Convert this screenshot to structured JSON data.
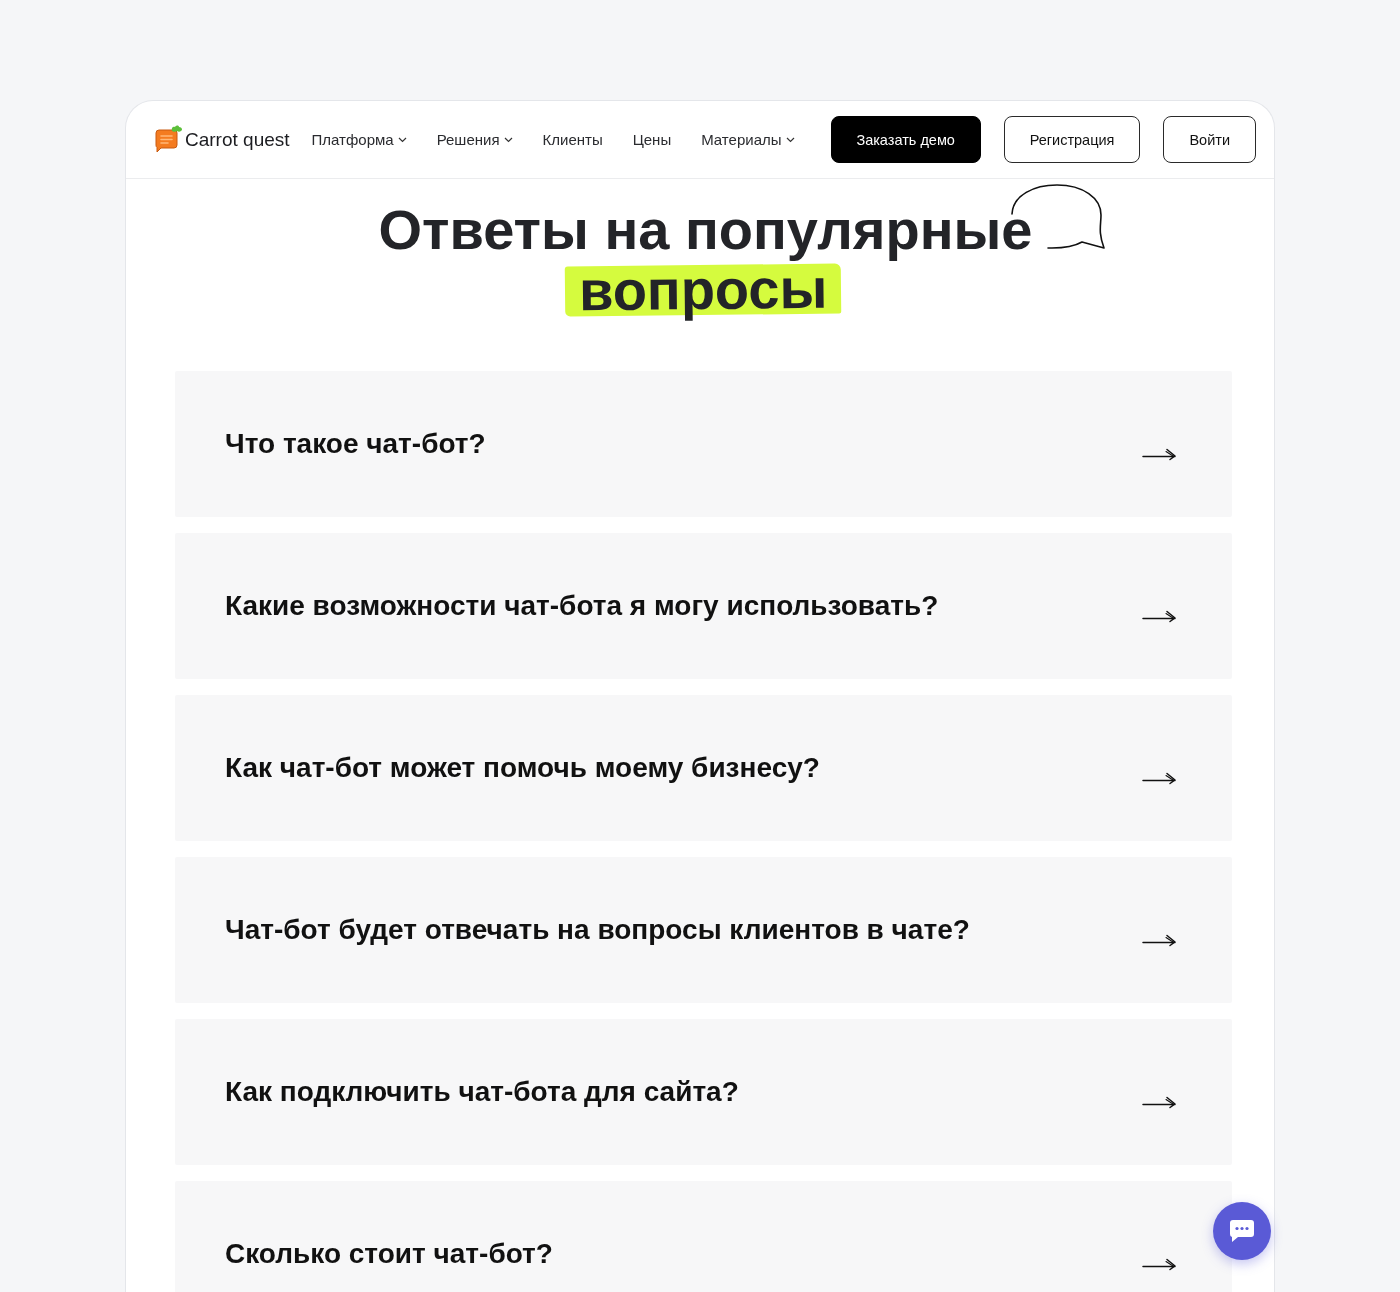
{
  "header": {
    "logo": {
      "text": "Carrot quest"
    },
    "nav": [
      {
        "label": "Платформа",
        "dropdown": true
      },
      {
        "label": "Решения",
        "dropdown": true
      },
      {
        "label": "Клиенты",
        "dropdown": false
      },
      {
        "label": "Цены",
        "dropdown": false
      },
      {
        "label": "Материалы",
        "dropdown": true
      }
    ],
    "buttons": [
      {
        "label": "Заказать демо",
        "kind": "filled"
      },
      {
        "label": "Регистрация",
        "kind": "outline"
      },
      {
        "label": "Войти",
        "kind": "outline"
      }
    ]
  },
  "faq": {
    "title": "Ответы на популярные",
    "title_highlight": "вопросы",
    "items": [
      {
        "question": "Что такое чат-бот?"
      },
      {
        "question": "Какие возможности чат-бота я могу использовать?"
      },
      {
        "question": "Как чат-бот может помочь моему бизнесу?"
      },
      {
        "question": "Чат-бот будет отвечать на вопросы клиентов в чате?"
      },
      {
        "question": "Как подключить чат-бота для сайта?"
      },
      {
        "question": "Сколько стоит чат-бот?"
      }
    ]
  }
}
